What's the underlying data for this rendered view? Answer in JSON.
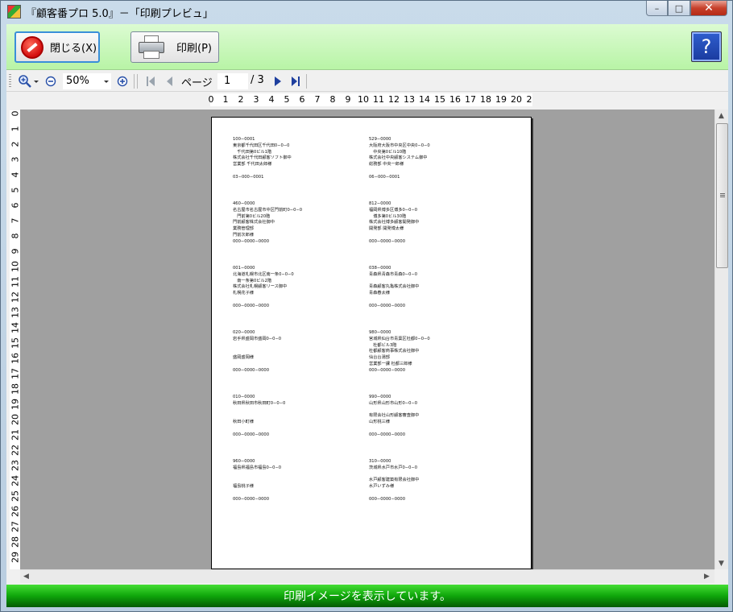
{
  "window": {
    "title": "『顧客番プロ 5.0』－「印刷プレビュ」",
    "min_glyph": "–",
    "max_glyph": "□",
    "close_glyph": "✕"
  },
  "commands": {
    "close_label": "閉じる(X)",
    "print_label": "印刷(P)",
    "help_glyph": "?"
  },
  "toolbar": {
    "zoom_value": "50%",
    "page_label": "ページ",
    "page_current": "1",
    "page_total": "/ 3"
  },
  "hruler": [
    "0",
    "1",
    "2",
    "3",
    "4",
    "5",
    "6",
    "7",
    "8",
    "9",
    "10",
    "11",
    "12",
    "13",
    "14",
    "15",
    "16",
    "17",
    "18",
    "19",
    "20",
    "2"
  ],
  "vruler": [
    "0",
    "1",
    "2",
    "3",
    "4",
    "5",
    "6",
    "7",
    "8",
    "9",
    "10",
    "11",
    "12",
    "13",
    "14",
    "15",
    "16",
    "17",
    "18",
    "19",
    "20",
    "21",
    "22",
    "23",
    "24",
    "25",
    "26",
    "27",
    "28",
    "29"
  ],
  "labels": [
    {
      "lines": [
        "100−0001",
        "東京都千代田区千代田0−0−0",
        "　千代田第0ビル1階",
        "株式会社千代田顧客ソフト御中",
        "営業部 千代田太郎様",
        "",
        "03−000−0001"
      ]
    },
    {
      "lines": [
        "529−0000",
        "大阪府大阪市中央区中央0−0−0",
        "　中央第0ビル10階",
        "株式会社中央顧客システム御中",
        "総務部 中央一郎様",
        "",
        "06−000−0001"
      ]
    },
    {
      "lines": [
        "460−0000",
        "名古屋市名古屋市中区門前町0−0−0",
        "　門前第0ビル20階",
        "門前顧客株式会社御中",
        "業務管理部",
        "門前次郎様",
        "000−0000−0000"
      ]
    },
    {
      "lines": [
        "812−0000",
        "福岡県博多区博多0−0−0",
        "　博多第0ビル30階",
        "株式会社博多顧客開発御中",
        "開発部 開発博太様",
        "",
        "000−0000−0000"
      ]
    },
    {
      "lines": [
        "001−0000",
        "北海道札幌市北区南一条0−0−0",
        "　南一条第0ビル2階",
        "株式会社札幌顧客リース御中",
        "札幌花子様",
        "",
        "000−0000−0000"
      ]
    },
    {
      "lines": [
        "038−0000",
        "青森県青森市青森0−0−0",
        "",
        "青森顧客丸亀株式会社御中",
        "青森春太様",
        "",
        "000−0000−0000"
      ]
    },
    {
      "lines": [
        "020−0000",
        "岩手県盛岡市盛岡0−0−0",
        "",
        "",
        "盛岡盛岡様",
        "",
        "000−0000−0000"
      ]
    },
    {
      "lines": [
        "980−0000",
        "宮城県仙台市青葉区杜都0−0−0",
        "　杜都ビル3階",
        "杜都顧客商事株式会社御中",
        "仙台台湯部",
        "営業部一課 杜都三郎様",
        "000−0000−0000"
      ]
    },
    {
      "lines": [
        "010−0000",
        "秋田県秋田市秋田町0−0−0",
        "",
        "",
        "秋田小町様",
        "",
        "000−0000−0000"
      ]
    },
    {
      "lines": [
        "990−0000",
        "山形県山形市山形0−0−0",
        "",
        "有限会社山形顧客審査御中",
        "山形桃三様",
        "",
        "000−0000−0000"
      ]
    },
    {
      "lines": [
        "960−0000",
        "福島県福島市福島0−0−0",
        "",
        "",
        "福島桃子様",
        "",
        "000−0000−0000"
      ]
    },
    {
      "lines": [
        "310−0000",
        "茨城県水戸市水戸0−0−0",
        "",
        "水戸顧客建築有限会社御中",
        "水戸いずみ様",
        "",
        "000−0000−0000"
      ]
    }
  ],
  "status": {
    "message": "印刷イメージを表示しています。"
  }
}
